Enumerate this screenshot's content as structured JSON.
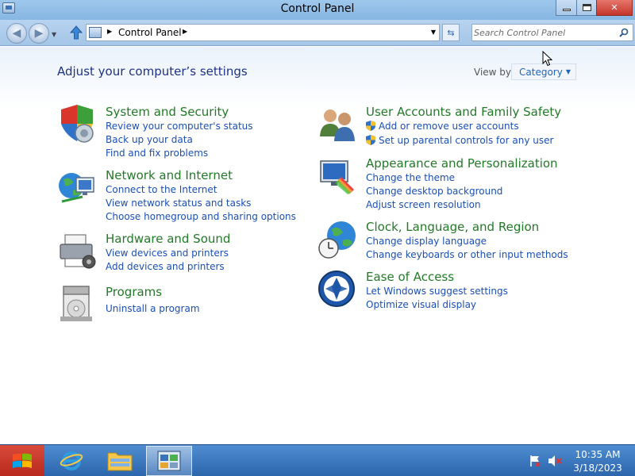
{
  "window": {
    "title": "Control Panel"
  },
  "navbar": {
    "breadcrumb": "Control Panel",
    "search_placeholder": "Search Control Panel"
  },
  "content": {
    "page_title": "Adjust your computer’s settings",
    "viewby_label": "View by:",
    "viewby_value": "Category"
  },
  "categories": [
    {
      "icon": "system-security-icon",
      "title": "System and Security",
      "links": [
        "Review your computer's status",
        "Back up your data",
        "Find and fix problems"
      ]
    },
    {
      "icon": "network-internet-icon",
      "title": "Network and Internet",
      "links": [
        "Connect to the Internet",
        "View network status and tasks",
        "Choose homegroup and sharing options"
      ]
    },
    {
      "icon": "hardware-sound-icon",
      "title": "Hardware and Sound",
      "links": [
        "View devices and printers",
        "Add devices and printers"
      ]
    },
    {
      "icon": "programs-icon",
      "title": "Programs",
      "links": [
        "Uninstall a program"
      ]
    },
    {
      "icon": "user-accounts-icon",
      "title": "User Accounts and Family Safety",
      "links": [
        "Add or remove user accounts",
        "Set up parental controls for any user"
      ]
    },
    {
      "icon": "appearance-icon",
      "title": "Appearance and Personalization",
      "links": [
        "Change the theme",
        "Change desktop background",
        "Adjust screen resolution"
      ]
    },
    {
      "icon": "clock-language-icon",
      "title": "Clock, Language, and Region",
      "links": [
        "Change display language",
        "Change keyboards or other input methods"
      ]
    },
    {
      "icon": "ease-of-access-icon",
      "title": "Ease of Access",
      "links": [
        "Let Windows suggest settings",
        "Optimize visual display"
      ]
    }
  ],
  "taskbar": {
    "time": "10:35 AM",
    "date": "3/18/2023"
  },
  "colors": {
    "category_title": "#227a27",
    "link": "#1a4fb4",
    "page_title": "#1e3287",
    "titlebar": "#9ec7ec",
    "taskbar": "#3a78c2",
    "close_button": "#c4352a"
  }
}
